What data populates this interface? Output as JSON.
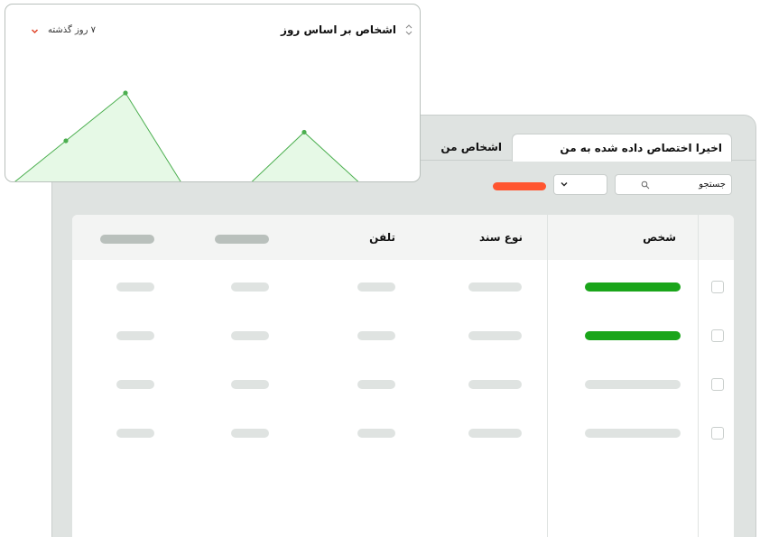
{
  "tabs": {
    "recent_assigned": "اخیرا اختصاص داده شده به من",
    "my_persons": "اشخاص من"
  },
  "search": {
    "value": "جستجو"
  },
  "table": {
    "headers": {
      "person": "شخص",
      "doc_type": "نوع سند",
      "phone": "تلفن"
    },
    "rows": [
      {
        "person_status": "highlighted"
      },
      {
        "person_status": "highlighted"
      },
      {
        "person_status": "placeholder"
      },
      {
        "person_status": "placeholder"
      }
    ]
  },
  "chart_card": {
    "title": "اشخاص بر اساس روز",
    "period": "۷ روز گذشته",
    "chart_data": {
      "type": "area",
      "x": [
        1,
        2,
        3,
        4,
        5,
        6,
        7,
        8
      ],
      "values": [
        0,
        0.5,
        1.0,
        0,
        0,
        0.59,
        0.02,
        0
      ],
      "line_color": "#4caf50",
      "fill_color": "#e6f9e6"
    }
  },
  "colors": {
    "accent_red": "#ff5530",
    "accent_green": "#1aa51a"
  }
}
